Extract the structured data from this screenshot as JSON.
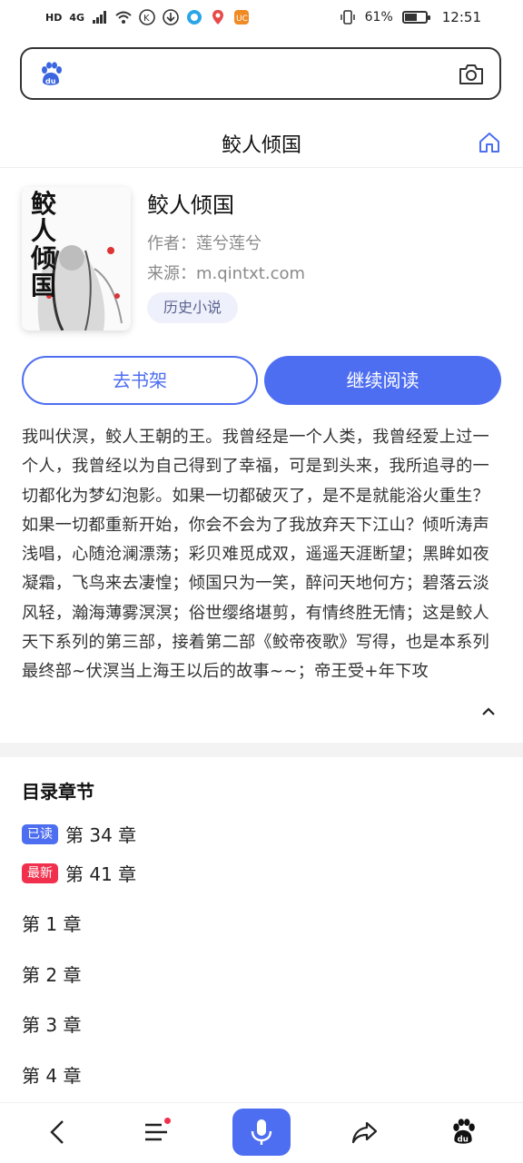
{
  "status_bar": {
    "left_chips": [
      "HD",
      "4G"
    ],
    "battery": "61%",
    "time": "12:51",
    "battery_level": 0.61
  },
  "search": {
    "placeholder": "",
    "value": ""
  },
  "header": {
    "title": "鲛人倾国"
  },
  "book": {
    "title": "鲛人倾国",
    "author_line": "作者：莲兮莲兮",
    "source_line": "来源：m.qintxt.com",
    "tag": "历史小说",
    "cover_text": "鲛人倾国"
  },
  "actions": {
    "shelf": "去书架",
    "read": "继续阅读"
  },
  "description": "我叫伏溟，鲛人王朝的王。我曾经是一个人类，我曾经爱上过一个人，我曾经以为自己得到了幸福，可是到头来，我所追寻的一切都化为梦幻泡影。如果一切都破灭了，是不是就能浴火重生？如果一切都重新开始，你会不会为了我放弃天下江山？倾听涛声浅唱，心随沧澜漂荡；彩贝难觅成双，遥遥天涯断望；黑眸如夜凝霜，飞鸟来去凄惶；倾国只为一笑，醉问天地何方；碧落云淡风轻，瀚海薄雾溟溟；俗世缨络堪剪，有情终胜无情；这是鲛人天下系列的第三部，接着第二部《鲛帝夜歌》写得，也是本系列最终部~伏溟当上海王以后的故事~~；帝王受+年下攻",
  "toc": {
    "title": "目录章节",
    "read_badge": "已读",
    "read_chapter": "第 34 章",
    "new_badge": "最新",
    "new_chapter": "第 41 章",
    "chapters": [
      "第 1 章",
      "第 2 章",
      "第 3 章",
      "第 4 章"
    ]
  },
  "icons": {
    "search_logo": "baidu-paw-icon",
    "camera": "camera-icon",
    "home": "home-icon",
    "collapse": "chevron-up-icon",
    "back": "back-icon",
    "menu": "menu-icon",
    "mic": "microphone-icon",
    "share": "share-icon",
    "baidu": "baidu-paw-icon"
  },
  "colors": {
    "accent": "#4e6ef2",
    "new_badge": "#f1304d",
    "tag_bg": "#eef0fb"
  }
}
